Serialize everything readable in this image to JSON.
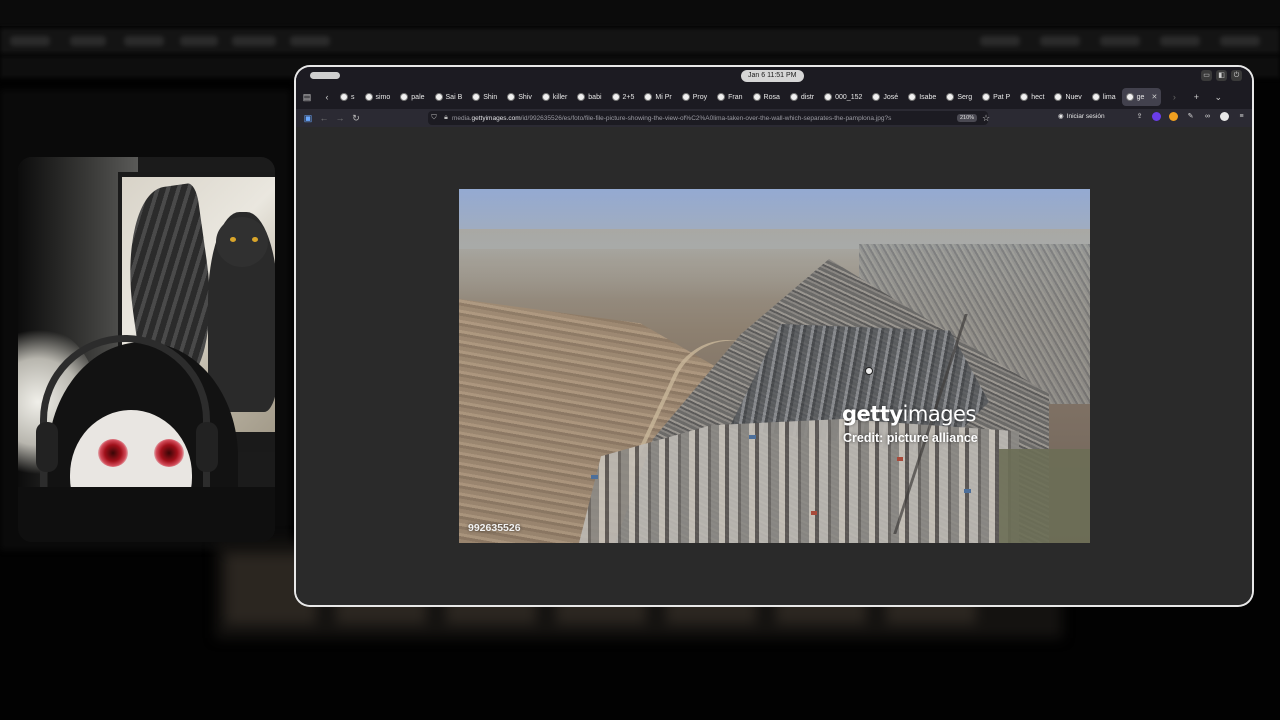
{
  "desktop": {
    "clock": "Jan 6  11:51 PM"
  },
  "browser": {
    "tabs": [
      {
        "label": "s"
      },
      {
        "label": "simo"
      },
      {
        "label": "pale"
      },
      {
        "label": "Sai B"
      },
      {
        "label": "Shin"
      },
      {
        "label": "Shiv"
      },
      {
        "label": "killer"
      },
      {
        "label": "babi"
      },
      {
        "label": "2+5"
      },
      {
        "label": "Mi Pr"
      },
      {
        "label": "Proy"
      },
      {
        "label": "Fran"
      },
      {
        "label": "Rosa"
      },
      {
        "label": "distr"
      },
      {
        "label": "000_152"
      },
      {
        "label": "José"
      },
      {
        "label": "Isabe"
      },
      {
        "label": "Serg"
      },
      {
        "label": "Pat P"
      },
      {
        "label": "hect"
      },
      {
        "label": "Nuev"
      },
      {
        "label": "lima"
      },
      {
        "label": "ge"
      }
    ],
    "active_tab_index": 22,
    "url_prefix": "media.",
    "url_domain": "gettyimages.com",
    "url_path": "/id/992635526/es/foto/file-file-picture-showing-the-view-of%C2%A0lima-taken-over-the-wall-which-separates-the-pamplona.jpg?s",
    "zoom": "210%",
    "signin_label": "Iniciar sesión"
  },
  "image": {
    "logo_text_bold": "getty",
    "logo_text": "images",
    "credit": "Credit: picture alliance",
    "image_id": "992635526"
  }
}
